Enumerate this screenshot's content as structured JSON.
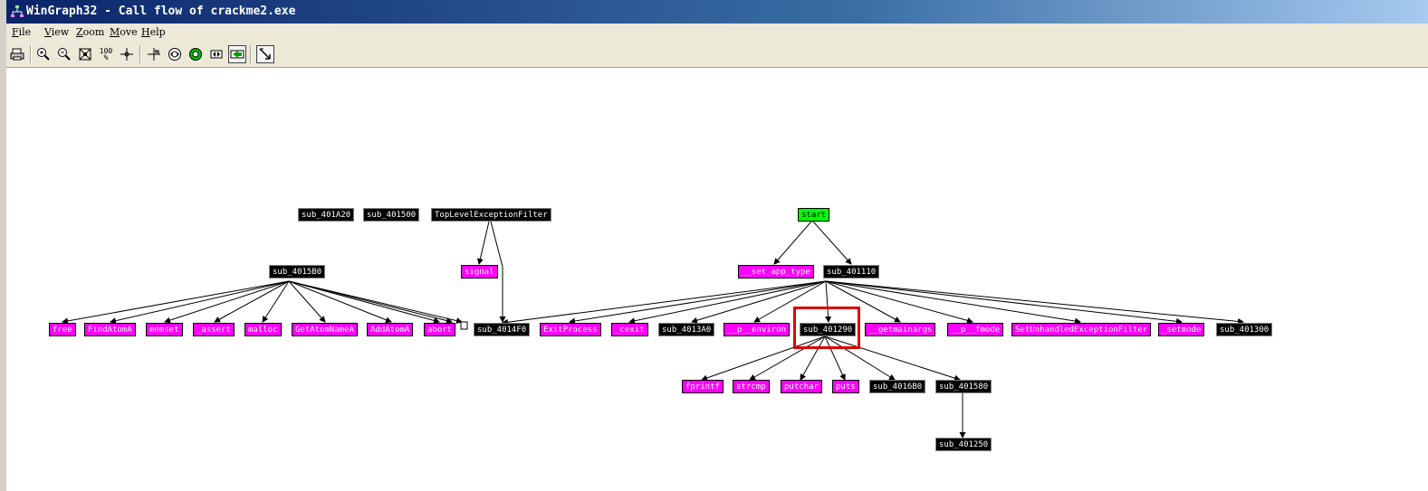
{
  "window": {
    "title": "WinGraph32 - Call flow of crackme2.exe",
    "icon": "graph-icon"
  },
  "menu": [
    {
      "key": "F",
      "rest": "ile"
    },
    {
      "key": "V",
      "rest": "iew"
    },
    {
      "key": "Z",
      "rest": "oom"
    },
    {
      "key": "M",
      "rest": "ove"
    },
    {
      "key": "H",
      "rest": "elp"
    }
  ],
  "toolbar": {
    "print": "printer-icon",
    "zoom_in": "zoom-in-icon",
    "zoom_out": "zoom-out-icon",
    "fit": "fit-icon",
    "zoom_100": "100 %",
    "center": "crosshair-icon",
    "layout_a": "layout-icon",
    "layout_b": "circle-icon",
    "layout_c": "green-circle-icon",
    "layout_d": "arrows-icon",
    "layout_e": "green-arrow-icon",
    "pointer": "pointer-icon"
  },
  "graph": {
    "colors": {
      "function": "#000000",
      "import": "#ff00ff",
      "entry": "#00ff00",
      "highlight": "#e00000"
    },
    "nodes": {
      "sub_401A20": "sub_401A20",
      "sub_401500": "sub_401500",
      "TopLevelExceptionFilter": "TopLevelExceptionFilter",
      "start": "start",
      "sub_4015B0": "sub_4015B0",
      "signal": "signal",
      "__set_app_type": "__set_app_type",
      "sub_401110": "sub_401110",
      "free": "free",
      "FindAtomA": "FindAtomA",
      "memset": "memset",
      "_assert": "_assert",
      "malloc": "malloc",
      "GetAtomNameA": "GetAtomNameA",
      "AddAtomA": "AddAtomA",
      "abort": "abort",
      "sub_4014F0": "sub_4014F0",
      "ExitProcess": "ExitProcess",
      "_cexit": "_cexit",
      "sub_4013A0": "sub_4013A0",
      "__p__environ": "__p__environ",
      "sub_401290": "sub_401290",
      "__getmainargs": "__getmainargs",
      "__p__fmode": "__p__fmode",
      "SetUnhandledExceptionFilter": "SetUnhandledExceptionFilter",
      "_setmode": "_setmode",
      "sub_401300": "sub_401300",
      "fprintf": "fprintf",
      "strcmp": "strcmp",
      "putchar": "putchar",
      "puts": "puts",
      "sub_4016B0": "sub_4016B0",
      "sub_401580": "sub_401580",
      "sub_401250": "sub_401250"
    }
  }
}
